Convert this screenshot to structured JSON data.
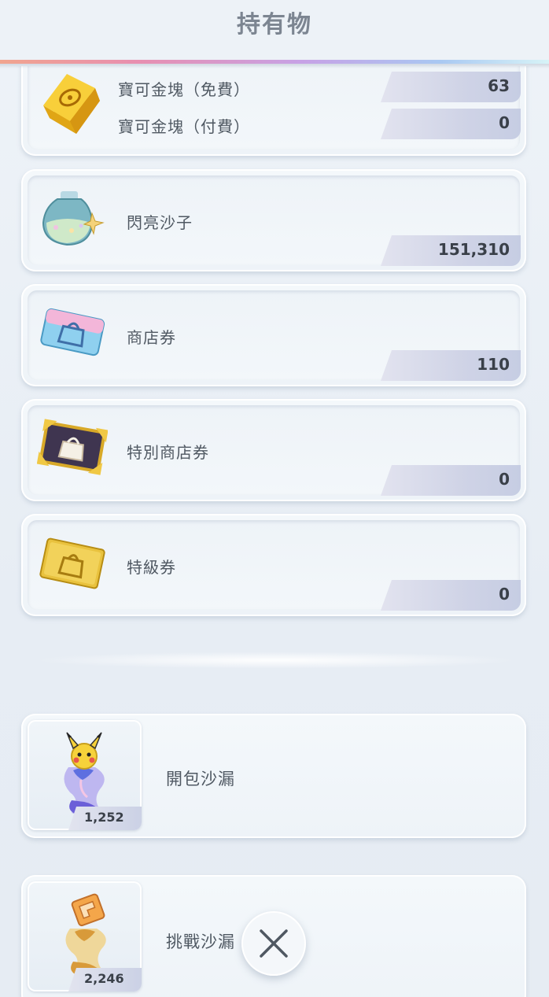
{
  "header": {
    "title": "持有物"
  },
  "items": [
    {
      "type": "double",
      "icon": "gold-bar-icon",
      "rows": [
        {
          "label": "寶可金塊（免費）",
          "value": "63"
        },
        {
          "label": "寶可金塊（付費）",
          "value": "0"
        }
      ]
    },
    {
      "type": "single",
      "icon": "shiny-sand-bottle-icon",
      "label": "閃亮沙子",
      "value": "151,310"
    },
    {
      "type": "single",
      "icon": "shop-ticket-icon",
      "label": "商店券",
      "value": "110"
    },
    {
      "type": "single",
      "icon": "special-shop-ticket-icon",
      "label": "特別商店券",
      "value": "0"
    },
    {
      "type": "single",
      "icon": "premium-ticket-icon",
      "label": "特級券",
      "value": "0"
    }
  ],
  "hourglasses": [
    {
      "icon": "pack-hourglass-icon",
      "label": "開包沙漏",
      "count": "1,252"
    },
    {
      "icon": "challenge-hourglass-icon",
      "label": "挑戰沙漏",
      "count": "2,246"
    }
  ],
  "close_button": {
    "icon": "close-icon"
  },
  "colors": {
    "accent_line": [
      "#f1a58f",
      "#e88fb0",
      "#c7a2e6",
      "#a9c8f2"
    ],
    "text": "#4f5862",
    "value_text": "#3a4049"
  }
}
